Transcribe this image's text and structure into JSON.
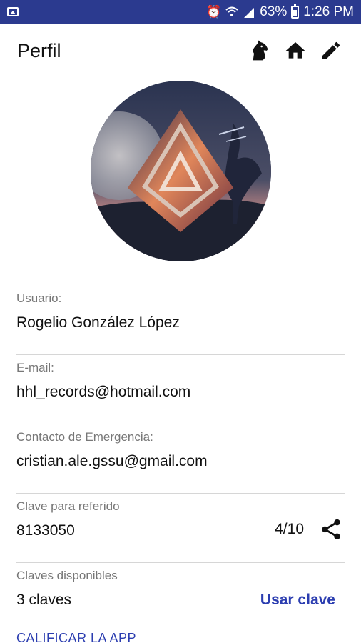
{
  "status_bar": {
    "battery": "63%",
    "time": "1:26 PM",
    "icons": [
      "image-icon",
      "alarm-icon",
      "wifi-icon",
      "signal-icon",
      "battery-icon"
    ]
  },
  "app_bar": {
    "title": "Perfil",
    "actions": [
      "horse-icon",
      "home-icon",
      "edit-icon"
    ]
  },
  "fields": {
    "user": {
      "label": "Usuario:",
      "value": "Rogelio González López"
    },
    "email": {
      "label": "E-mail:",
      "value": "hhl_records@hotmail.com"
    },
    "emergency": {
      "label": "Contacto de Emergencia:",
      "value": "cristian.ale.gssu@gmail.com"
    },
    "referral": {
      "label": "Clave para referido",
      "value": "8133050",
      "counter": "4/10"
    },
    "keys": {
      "label": "Claves disponibles",
      "value": "3 claves",
      "action": "Usar clave"
    }
  },
  "footer": {
    "rate_app": "CALIFICAR LA APP"
  },
  "colors": {
    "status_bar": "#2b3a8f",
    "accent": "#2b3db0"
  }
}
